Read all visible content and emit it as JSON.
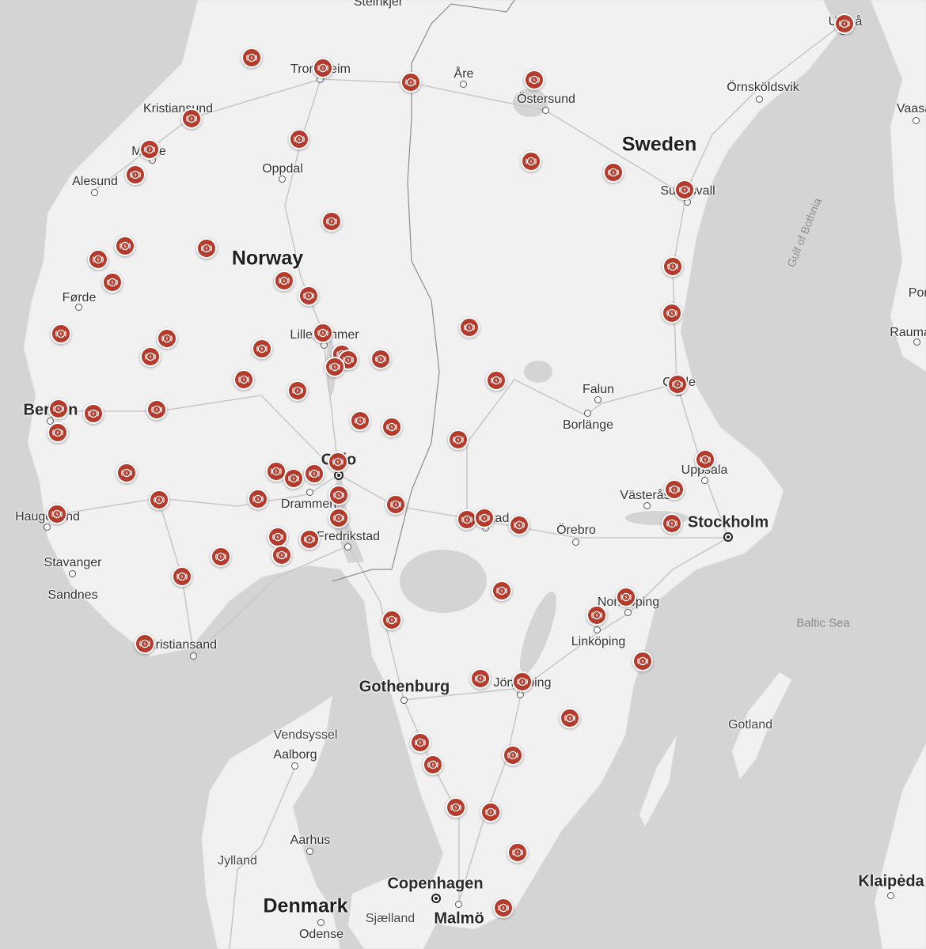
{
  "map": {
    "colors": {
      "water": "#d4d4d4",
      "land": "#f1f1f1",
      "road": "#c9c9c9",
      "charger": "#b63a2c"
    },
    "marker_icon": "supercharger-icon",
    "labels": [
      {
        "text": "Steinkjer",
        "type": "city"
      },
      {
        "text": "Trondheim",
        "type": "city"
      },
      {
        "text": "Åre",
        "type": "city"
      },
      {
        "text": "Östersund",
        "type": "city"
      },
      {
        "text": "Umeå",
        "type": "city"
      },
      {
        "text": "Örnsköldsvik",
        "type": "city"
      },
      {
        "text": "Vaasa",
        "type": "city"
      },
      {
        "text": "Kristiansund",
        "type": "city"
      },
      {
        "text": "Molde",
        "type": "city"
      },
      {
        "text": "Alesund",
        "type": "city"
      },
      {
        "text": "Oppdal",
        "type": "city"
      },
      {
        "text": "Sweden",
        "type": "country"
      },
      {
        "text": "Sundsvall",
        "type": "city"
      },
      {
        "text": "Gulf of Bothnia",
        "type": "gulf"
      },
      {
        "text": "Norway",
        "type": "country"
      },
      {
        "text": "Førde",
        "type": "city"
      },
      {
        "text": "Lillehammer",
        "type": "city"
      },
      {
        "text": "Pori",
        "type": "city"
      },
      {
        "text": "Rauma",
        "type": "city"
      },
      {
        "text": "Falun",
        "type": "city"
      },
      {
        "text": "Gävle",
        "type": "city"
      },
      {
        "text": "Borlänge",
        "type": "city"
      },
      {
        "text": "Bergen",
        "type": "bigcity"
      },
      {
        "text": "Oslo",
        "type": "bigcity"
      },
      {
        "text": "Uppsala",
        "type": "city"
      },
      {
        "text": "Drammen",
        "type": "city"
      },
      {
        "text": "Västerås",
        "type": "city"
      },
      {
        "text": "Haugesund",
        "type": "city"
      },
      {
        "text": "Karlstad",
        "type": "city"
      },
      {
        "text": "Stockholm",
        "type": "bigcity"
      },
      {
        "text": "Fredrikstad",
        "type": "city"
      },
      {
        "text": "Örebro",
        "type": "city"
      },
      {
        "text": "Stavanger",
        "type": "city"
      },
      {
        "text": "Sandnes",
        "type": "city"
      },
      {
        "text": "Norrköping",
        "type": "city"
      },
      {
        "text": "Baltic Sea",
        "type": "water"
      },
      {
        "text": "Linköping",
        "type": "city"
      },
      {
        "text": "Kristiansand",
        "type": "city"
      },
      {
        "text": "Gothenburg",
        "type": "bigcity"
      },
      {
        "text": "Jönköping",
        "type": "city"
      },
      {
        "text": "Gotland",
        "type": "region"
      },
      {
        "text": "Vendsyssel",
        "type": "region"
      },
      {
        "text": "Aalborg",
        "type": "city"
      },
      {
        "text": "Aarhus",
        "type": "city"
      },
      {
        "text": "Jylland",
        "type": "region"
      },
      {
        "text": "Copenhagen",
        "type": "bigcity"
      },
      {
        "text": "Denmark",
        "type": "country"
      },
      {
        "text": "Sjælland",
        "type": "region"
      },
      {
        "text": "Malmö",
        "type": "bigcity"
      },
      {
        "text": "Odense",
        "type": "city"
      },
      {
        "text": "Klaipėda",
        "type": "bigcity"
      }
    ]
  }
}
